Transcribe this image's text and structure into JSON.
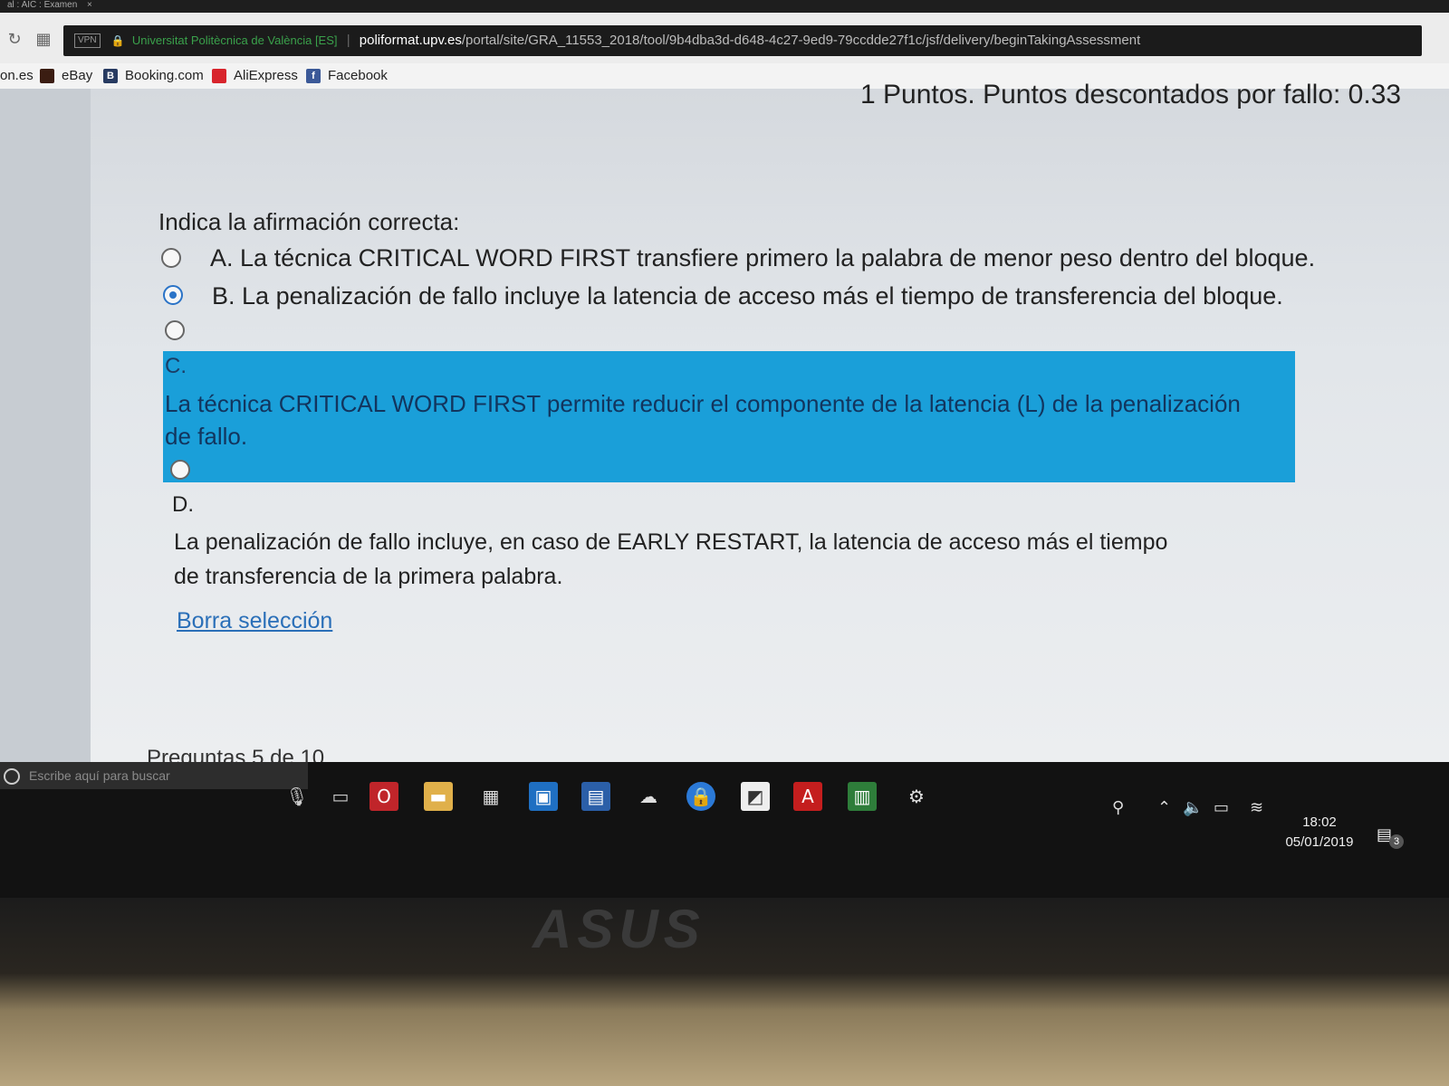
{
  "browser": {
    "tab_title": "al : AIC : Examen",
    "tab_close": "×",
    "vpn_badge": "VPN",
    "site_name": "Universitat Politècnica de València [ES]",
    "url_host": "poliformat.upv.es",
    "url_path": "/portal/site/GRA_11553_2018/tool/9b4dba3d-d648-4c27-9ed9-79ccdde27f1c/jsf/delivery/beginTakingAssessment",
    "bookmarks": [
      {
        "label": "on.es",
        "icon": "bookmark-icon",
        "color": ""
      },
      {
        "label": "eBay",
        "icon": "ebay-bag-icon",
        "color": "#3b1d12"
      },
      {
        "label": "Booking.com",
        "icon": "booking-icon",
        "color": "#273a61",
        "glyph": "B"
      },
      {
        "label": "AliExpress",
        "icon": "aliexpress-icon",
        "color": "#d8242c"
      },
      {
        "label": "Facebook",
        "icon": "facebook-icon",
        "color": "#3b5998",
        "glyph": "f"
      }
    ]
  },
  "quiz": {
    "points": "1 Puntos. Puntos descontados por fallo: 0.33",
    "question": "Indica la afirmación correcta:",
    "options": [
      {
        "letter": "A.",
        "text": "La técnica CRITICAL WORD FIRST transfiere primero la palabra de menor peso dentro del bloque.",
        "selected": false
      },
      {
        "letter": "B.",
        "text": "La penalización de fallo incluye la latencia de acceso más el tiempo de transferencia del bloque.",
        "selected": true
      },
      {
        "letter": "C.",
        "text": "La técnica CRITICAL WORD FIRST permite reducir el componente de la latencia (L) de la penalización de fallo.",
        "selected": false
      },
      {
        "letter": "D.",
        "text": "La penalización de fallo incluye, en caso de EARLY RESTART, la latencia de acceso más el tiempo de transferencia de la primera palabra.",
        "selected": false
      }
    ],
    "clear_selection": "Borra selección",
    "progress": "Preguntas 5 de 10",
    "highlight_color": "#1a9fd9"
  },
  "taskbar": {
    "search_placeholder": "Escribe aquí para buscar",
    "time": "18:02",
    "date": "05/01/2019",
    "notification_count": "3"
  },
  "hardware": {
    "brand": "ASUS"
  }
}
